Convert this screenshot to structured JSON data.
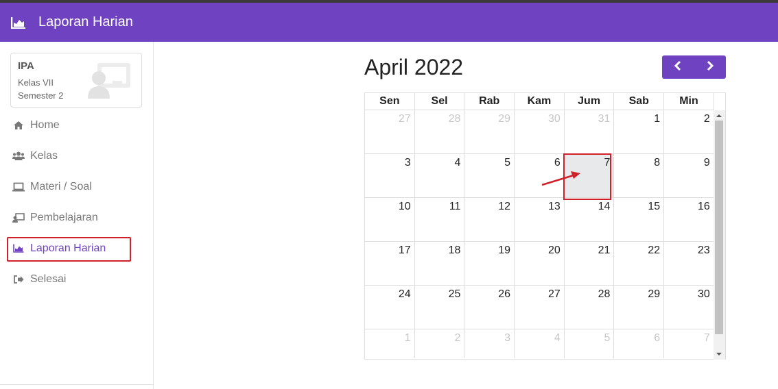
{
  "header": {
    "title": "Laporan Harian",
    "icon": "area-chart-icon",
    "color": "#6f42c1"
  },
  "profile": {
    "subject": "IPA",
    "class": "Kelas VII",
    "semester": "Semester 2",
    "icon": "chalkboard-teacher-icon"
  },
  "nav": [
    {
      "label": "Home",
      "icon": "home-icon"
    },
    {
      "label": "Kelas",
      "icon": "users-icon"
    },
    {
      "label": "Materi / Soal",
      "icon": "laptop-icon"
    },
    {
      "label": "Pembelajaran",
      "icon": "chalkboard-icon"
    },
    {
      "label": "Laporan Harian",
      "icon": "area-chart-icon",
      "active": true
    },
    {
      "label": "Selesai",
      "icon": "sign-out-icon"
    }
  ],
  "calendar": {
    "title": "April 2022",
    "weekdays": [
      "Sen",
      "Sel",
      "Rab",
      "Kam",
      "Jum",
      "Sab",
      "Min"
    ],
    "weeks": [
      [
        "27",
        "28",
        "29",
        "30",
        "31",
        "1",
        "2"
      ],
      [
        "3",
        "4",
        "5",
        "6",
        "7",
        "8",
        "9"
      ],
      [
        "10",
        "11",
        "12",
        "13",
        "14",
        "15",
        "16"
      ],
      [
        "17",
        "18",
        "19",
        "20",
        "21",
        "22",
        "23"
      ],
      [
        "24",
        "25",
        "26",
        "27",
        "28",
        "29",
        "30"
      ],
      [
        "1",
        "2",
        "3",
        "4",
        "5",
        "6",
        "7"
      ]
    ],
    "today": "7",
    "colors": {
      "accent": "#6f42c1",
      "highlight": "#d0202a",
      "today_bg": "#e8e9ea"
    }
  }
}
